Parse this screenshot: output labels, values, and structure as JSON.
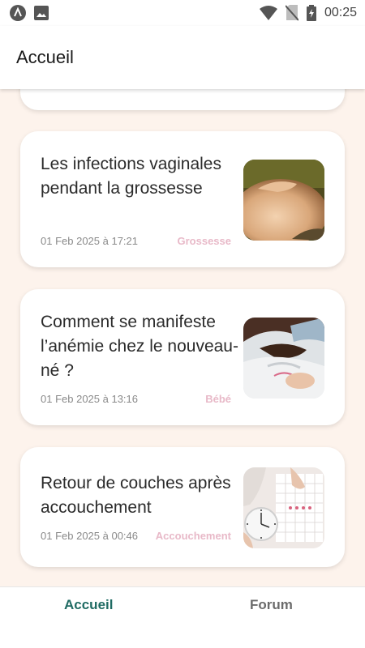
{
  "status_bar": {
    "time": "00:25",
    "icons_left": [
      "app-a-icon",
      "image-icon"
    ],
    "icons_right": [
      "wifi-icon",
      "no-sim-icon",
      "battery-charging-icon"
    ]
  },
  "app_bar": {
    "title": "Accueil"
  },
  "articles": [
    {
      "title": "Les infections vaginales pendant la grossesse",
      "date": "01 Feb 2025 à 17:21",
      "category": "Grossesse",
      "image": "pregnant-belly-image"
    },
    {
      "title": "Comment se manifeste l’anémie chez le nouveau-né ?",
      "date": "01 Feb 2025 à 13:16",
      "category": "Bébé",
      "image": "newborn-image"
    },
    {
      "title": "Retour de couches après accouchement",
      "date": "01 Feb 2025 à 00:46",
      "category": "Accouchement",
      "image": "calendar-clock-image"
    }
  ],
  "bottom_nav": {
    "home": "Accueil",
    "forum": "Forum"
  },
  "colors": {
    "accent": "#1f6b63",
    "tag": "#e8b9c8",
    "background": "#fdf3ec"
  }
}
